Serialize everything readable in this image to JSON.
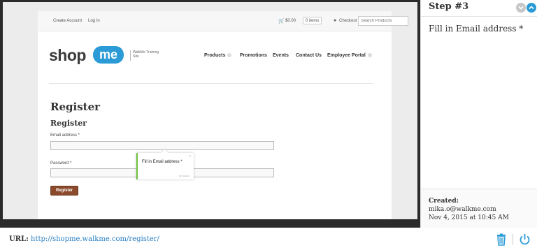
{
  "site": {
    "topbar": {
      "create_account": "Create Account",
      "log_in": "Log In",
      "cart_amount": "$0.00",
      "items": "0 items",
      "checkout": "Checkout",
      "search_placeholder": "Search Products"
    },
    "logo": {
      "shop": "shop",
      "me": "me",
      "subtitle": "WalkMe Training Site"
    },
    "nav": [
      "Products",
      "Promotions",
      "Events",
      "Contact Us",
      "Employee Portal"
    ],
    "page_title": "Register",
    "form_title": "Register",
    "email_label": "Email address *",
    "password_label": "Password *",
    "register_button": "Register"
  },
  "tooltip": {
    "text": "Fill in Email address *",
    "close": "×",
    "by": "By WalkMe"
  },
  "panel": {
    "title": "Step #3",
    "description": "Fill in Email address *",
    "created_label": "Created:",
    "created_by": "mika.o@walkme.com",
    "created_at": "Nov 4, 2015 at 10:45 AM"
  },
  "bottom": {
    "url_label": "URL:",
    "url": "http://shopme.walkme.com/register/"
  },
  "colors": {
    "accent": "#2a9bd6",
    "register_button": "#8a4a2b",
    "tooltip_border": "#6fc23f"
  },
  "icons": {
    "cart": "cart-icon",
    "checkout": "checkout-icon",
    "down": "chevron-down-icon",
    "up": "chevron-up-icon",
    "trash": "trash-icon",
    "power": "power-icon"
  }
}
